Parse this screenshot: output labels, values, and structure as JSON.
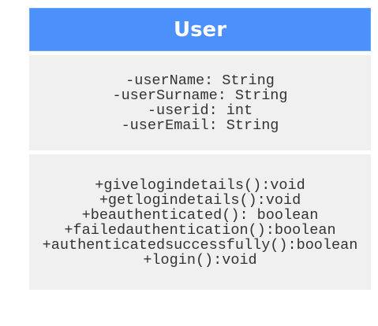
{
  "class": {
    "name": "User",
    "attributes": [
      "-userName: String",
      "-userSurname: String",
      "-userid: int",
      "-userEmail: String"
    ],
    "methods": [
      "+givelogindetails():void",
      "+getlogindetails():void",
      "+beauthenticated(): boolean",
      "+failedauthentication():boolean",
      "+authenticatedsuccessfully():boolean",
      "+login():void"
    ]
  },
  "colors": {
    "header": "#4b90fb",
    "compartment": "#f0f0f0",
    "text": "#333333"
  }
}
